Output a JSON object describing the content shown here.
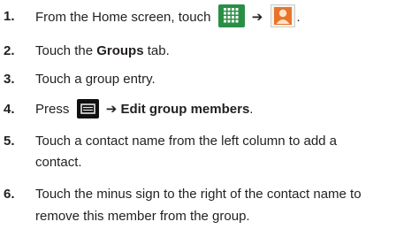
{
  "steps": [
    {
      "number": "1.",
      "text_before": "From the Home screen, touch",
      "arrow": "➔",
      "text_after": "."
    },
    {
      "number": "2.",
      "text_before": "Touch the",
      "bold": "Groups",
      "text_after": "tab."
    },
    {
      "number": "3.",
      "text": "Touch a group entry."
    },
    {
      "number": "4.",
      "text_before": "Press",
      "arrow": "➔",
      "bold": "Edit group members",
      "text_after": "."
    },
    {
      "number": "5.",
      "line1": "Touch a contact name from the left column to add a",
      "line2": "contact."
    },
    {
      "number": "6.",
      "line1": "Touch the minus sign to the right of the contact name to",
      "line2": "remove this member from the group."
    }
  ],
  "icons": {
    "apps": "apps-grid-icon",
    "contacts": "contacts-icon",
    "menu": "menu-key-icon"
  },
  "colors": {
    "text": "#231f20",
    "apps_icon_bg": "#2a8f45",
    "contacts_icon_orange": "#e8742a"
  }
}
